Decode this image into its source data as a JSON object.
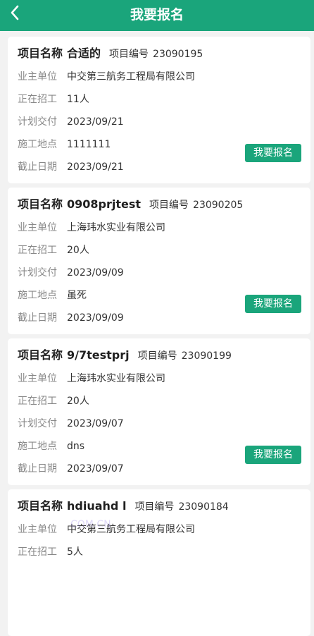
{
  "header": {
    "title": "我要报名",
    "back_icon": "chevron-left-icon",
    "background_color": "#1aa57b"
  },
  "labels": {
    "project_name": "项目名称",
    "project_no": "项目编号",
    "owner": "业主单位",
    "recruiting": "正在招工",
    "delivery": "计划交付",
    "location": "施工地点",
    "deadline": "截止日期",
    "signup_button": "我要报名"
  },
  "projects": [
    {
      "name": "合适的",
      "number": "23090195",
      "owner": "中交第三航务工程局有限公司",
      "recruiting": "11人",
      "delivery": "2023/09/21",
      "location": "1111111",
      "deadline": "2023/09/21"
    },
    {
      "name": "0908prjtest",
      "number": "23090205",
      "owner": "上海玮水实业有限公司",
      "recruiting": "20人",
      "delivery": "2023/09/09",
      "location": "虽死",
      "deadline": "2023/09/09"
    },
    {
      "name": "9/7testprj",
      "number": "23090199",
      "owner": "上海玮水实业有限公司",
      "recruiting": "20人",
      "delivery": "2023/09/07",
      "location": "dns",
      "deadline": "2023/09/07"
    },
    {
      "name": "hdiuahd l",
      "number": "23090184",
      "owner": "中交第三航务工程局有限公司",
      "recruiting": "5人",
      "delivery": "",
      "location": "",
      "deadline": ""
    }
  ],
  "watermark": "COM.CN",
  "colors": {
    "accent": "#1aa57b",
    "page_background": "#f2f2f2",
    "card_background": "#ffffff"
  }
}
